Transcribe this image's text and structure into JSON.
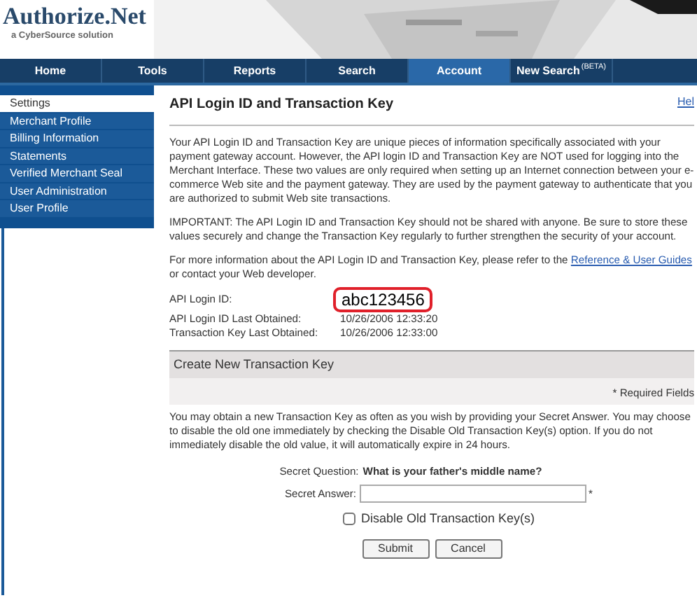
{
  "header": {
    "logo": "Authorize.Net",
    "tagline": "a CyberSource solution"
  },
  "nav": [
    {
      "label": "Home",
      "selected": false
    },
    {
      "label": "Tools",
      "selected": false
    },
    {
      "label": "Reports",
      "selected": false
    },
    {
      "label": "Search",
      "selected": false
    },
    {
      "label": "Account",
      "selected": true
    },
    {
      "label": "New Search",
      "sup": "(BETA)",
      "selected": false
    }
  ],
  "sidebar": [
    {
      "label": "Settings",
      "selected": true
    },
    {
      "label": "Merchant Profile",
      "selected": false
    },
    {
      "label": "Billing Information",
      "selected": false
    },
    {
      "label": "Statements",
      "selected": false
    },
    {
      "label": "Verified Merchant Seal",
      "selected": false
    },
    {
      "label": "User Administration",
      "selected": false
    },
    {
      "label": "User Profile",
      "selected": false
    }
  ],
  "page": {
    "title": "API Login ID and Transaction Key",
    "help_link": "Hel",
    "paragraphs": [
      "Your API Login ID and Transaction Key are unique pieces of information specifically associated with your payment gateway account. However, the API login ID and Transaction Key are NOT used for logging into the Merchant Interface. These two values are only required when setting up an Internet connection between your e-commerce Web site and the payment gateway. They are used by the payment gateway to authenticate that you are authorized to submit Web site transactions.",
      "IMPORTANT: The API Login ID and Transaction Key should not be shared with anyone. Be sure to store these values securely and change the Transaction Key regularly to further strengthen the security of your account."
    ],
    "more_info": {
      "before": "For more information about the API Login ID and Transaction Key, please refer to the",
      "link": "Reference & User Guides",
      "after": "or contact your Web developer."
    },
    "details": [
      {
        "label": "API Login ID:",
        "value": "abc123456",
        "highlighted": true
      },
      {
        "label": "API Login ID Last Obtained:",
        "value": "10/26/2006 12:33:20",
        "highlighted": false
      },
      {
        "label": "Transaction Key Last Obtained:",
        "value": "10/26/2006 12:33:00",
        "highlighted": false
      }
    ]
  },
  "create_section": {
    "title": "Create New Transaction Key",
    "required_note": "* Required Fields",
    "description": "You may obtain a new Transaction Key as often as you wish by providing your Secret Answer. You may choose to disable the old one immediately by checking the Disable Old Transaction Key(s) option. If you do not immediately disable the old value, it will automatically expire in 24 hours.",
    "question_label": "Secret Question:",
    "question": "What is your father's middle name?",
    "answer_label": "Secret Answer:",
    "required_mark": "*",
    "checkbox": {
      "label": "Disable Old Transaction Key(s)",
      "checked": false
    },
    "buttons": [
      "Submit",
      "Cancel"
    ]
  }
}
